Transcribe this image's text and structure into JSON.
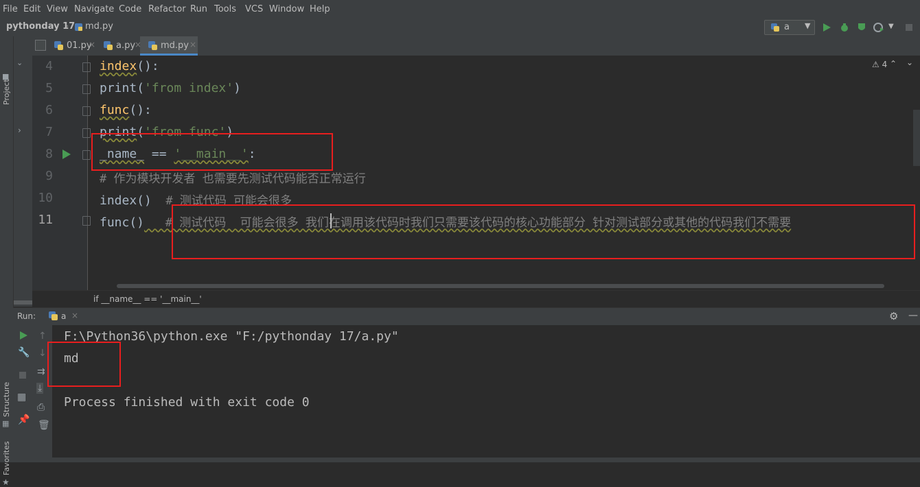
{
  "menu": [
    "File",
    "Edit",
    "View",
    "Navigate",
    "Code",
    "Refactor",
    "Run",
    "Tools",
    "VCS",
    "Window",
    "Help"
  ],
  "nav": {
    "project": "pythonday 17",
    "file": "md.py",
    "run_config": "a"
  },
  "sidebar": {
    "project_label": "Project",
    "structure_label": "Structure",
    "favorites_label": "Favorites"
  },
  "tabs": [
    {
      "label": "01.py",
      "active": false
    },
    {
      "label": "a.py",
      "active": false
    },
    {
      "label": "md.py",
      "active": true
    }
  ],
  "editor": {
    "warning_count": "4",
    "lines": [
      {
        "num": "4",
        "parts": [
          "index",
          "():"
        ]
      },
      {
        "num": "5",
        "parts": [
          "print",
          "(",
          "'from index'",
          ")"
        ]
      },
      {
        "num": "6",
        "parts": [
          "func",
          "():"
        ]
      },
      {
        "num": "7",
        "parts": [
          "print",
          "(",
          "'from func'",
          ")"
        ]
      },
      {
        "num": "8",
        "parts": [
          "_name_",
          " == ",
          "'__main__'",
          ":"
        ]
      },
      {
        "num": "9",
        "parts": [
          "# 作为模块开发者 也需要先测试代码能否正常运行"
        ]
      },
      {
        "num": "10",
        "parts": [
          "index()",
          "  # 测试代码 可能会很多"
        ]
      },
      {
        "num": "11",
        "parts": [
          "func()",
          "   # 测试代码  可能会很多",
          " 我们在调用该代码时我们只需要该代码的核心功能部分 针对测试部分或其他的代码我们不需要"
        ]
      }
    ],
    "breadcrumb": "if __name__ == '__main__'"
  },
  "run": {
    "label": "Run:",
    "tab": "a",
    "console": [
      "F:\\Python36\\python.exe \"F:/pythonday 17/a.py\"",
      "md",
      "",
      "Process finished with exit code 0"
    ]
  },
  "colors": {
    "highlight_box": "#e81e1e",
    "run_green": "#499c54"
  }
}
